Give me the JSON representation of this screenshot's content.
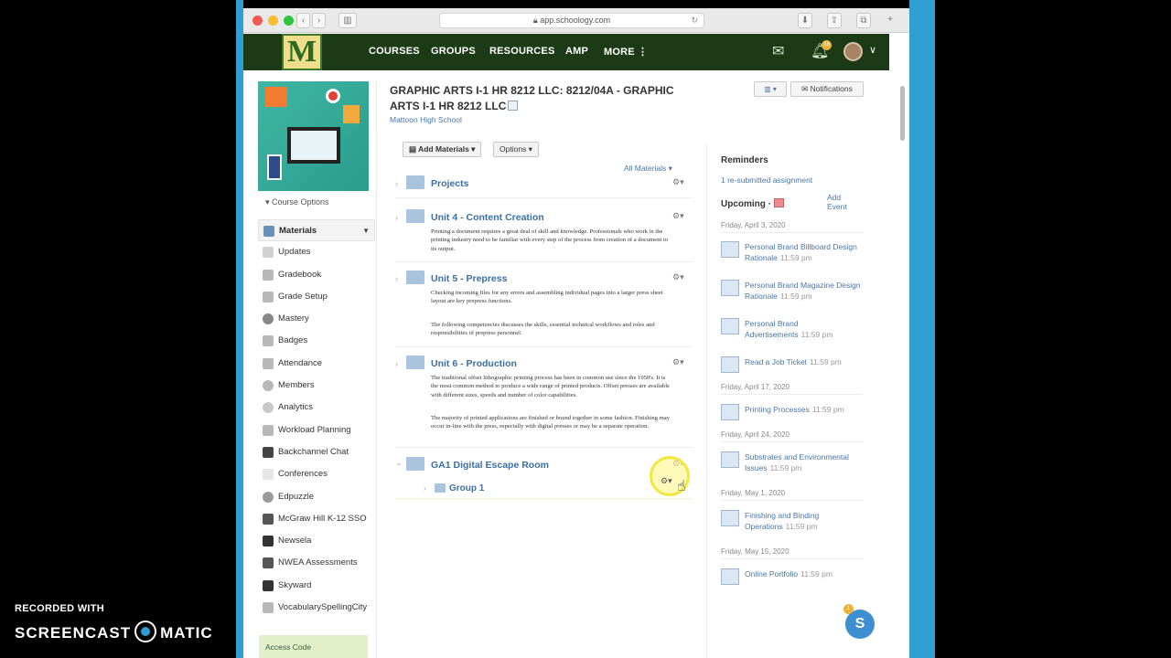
{
  "browser": {
    "url": "app.schoology.com",
    "lock_icon": "lock-icon"
  },
  "nav": {
    "logo": "M",
    "items": [
      "COURSES",
      "GROUPS",
      "RESOURCES",
      "AMP",
      "MORE ⋮"
    ],
    "notification_count": "16"
  },
  "sidebar": {
    "course_options": "Course Options",
    "menu": [
      {
        "label": "Materials",
        "active": true
      },
      {
        "label": "Updates"
      },
      {
        "label": "Gradebook"
      },
      {
        "label": "Grade Setup"
      },
      {
        "label": "Mastery"
      },
      {
        "label": "Badges"
      },
      {
        "label": "Attendance"
      },
      {
        "label": "Members"
      },
      {
        "label": "Analytics"
      },
      {
        "label": "Workload Planning"
      },
      {
        "label": "Backchannel Chat"
      },
      {
        "label": "Conferences"
      },
      {
        "label": "Edpuzzle"
      },
      {
        "label": "McGraw Hill K-12 SSO"
      },
      {
        "label": "Newsela"
      },
      {
        "label": "NWEA Assessments"
      },
      {
        "label": "Skyward"
      },
      {
        "label": "VocabularySpellingCity"
      }
    ],
    "access_code": "Access Code"
  },
  "main": {
    "course_title": "GRAPHIC ARTS I-1 HR 8212 LLC: 8212/04A - GRAPHIC ARTS I-1 HR 8212 LLC",
    "school": "Mattoon High School",
    "notifications_label": "Notifications",
    "add_materials_label": "Add Materials ▾",
    "options_label": "Options ▾",
    "all_materials_label": "All Materials ▾",
    "folders": [
      {
        "name": "Projects",
        "desc": ""
      },
      {
        "name": "Unit 4 - Content Creation",
        "desc": "Printing a document requires a great deal of skill and knowledge. Professionals who work in the printing industry need to be familiar with every step of the process from creation of a document to its output."
      },
      {
        "name": "Unit 5 - Prepress",
        "desc": "Checking incoming files for any errors and assembling individual pages into a larger press sheet layout are key prepress functions.",
        "desc2": "The following competencies discusses the skills, essential technical workflows and roles and responsibilities of prepress personnel."
      },
      {
        "name": "Unit 6 - Production",
        "desc": "The traditional offset lithographic printing process has been in common use since the 1950's. It is the most common method to produce a wide range of printed products. Offset presses are available with different sizes, speeds and number of color capabilities.",
        "desc2": "The majority of printed applications are finished or bound together in some fashion. Finishing may occur in-line with the press, especially with digital presses or may be a separate operation."
      },
      {
        "name": "GA1 Digital Escape Room",
        "desc": ""
      }
    ],
    "subfolder": "Group 1"
  },
  "right": {
    "reminders_title": "Reminders",
    "reminder_link": "1 re-submitted assignment",
    "upcoming_title": "Upcoming ·",
    "add_event": "Add Event",
    "dates": [
      "Friday, April 3, 2020",
      "Friday, April 17, 2020",
      "Friday, April 24, 2020",
      "Friday, May 1, 2020",
      "Friday, May 15, 2020"
    ],
    "assignments": [
      {
        "title": "Personal Brand Billboard Design Rationale",
        "time": "11:59 pm"
      },
      {
        "title": "Personal Brand Magazine Design Rationale",
        "time": "11:59 pm"
      },
      {
        "title": "Personal Brand Advertisements",
        "time": "11:59 pm"
      },
      {
        "title": "Read a Job Ticket",
        "time": "11:59 pm"
      },
      {
        "title": "Printing Processes",
        "time": "11:59 pm"
      },
      {
        "title": "Substrates and Environmental Issues",
        "time": "11:59 pm"
      },
      {
        "title": "Finishing and Binding Operations",
        "time": "11:59 pm"
      },
      {
        "title": "Online Portfolio",
        "time": "11:59 pm"
      }
    ]
  },
  "chat": {
    "letter": "S",
    "count": "1"
  },
  "watermark": {
    "recorded": "RECORDED WITH",
    "brand_a": "SCREENCAST",
    "brand_b": "MATIC"
  }
}
